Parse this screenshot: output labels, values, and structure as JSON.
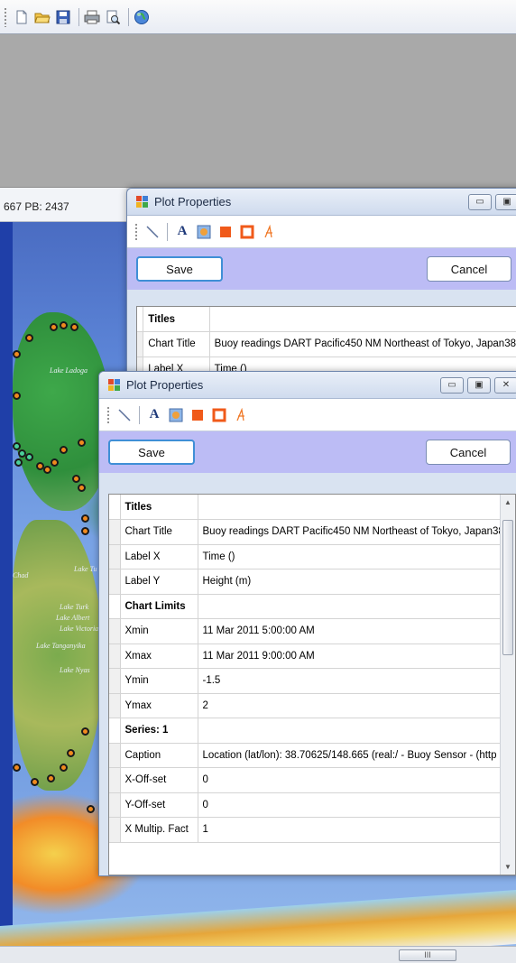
{
  "app": {
    "toolbar": {
      "icons": [
        "new-document-icon",
        "open-folder-icon",
        "save-icon",
        "print-icon",
        "print-preview-icon",
        "globe-icon"
      ]
    },
    "status": {
      "coordinates": "667 PB: 2437"
    },
    "scrollbar_thumb": "III"
  },
  "map": {
    "lake_labels": [
      "Lake Ladoga",
      "Lake Tu",
      "Chad",
      "Lake Turk",
      "Lake Albert",
      "Lake Victoria",
      "Lake Tanganyika",
      "Lake Nyas"
    ]
  },
  "colors": {
    "button_row": "#bcbcf5",
    "map_dot_orange": "#f08a1e",
    "map_dot_green": "#4ad09a",
    "focus_border": "#3f8fd6"
  },
  "dialog_back": {
    "title": "Plot Properties",
    "save_label": "Save",
    "cancel_label": "Cancel",
    "rows": [
      {
        "key": "Titles",
        "value": "",
        "section": true
      },
      {
        "key": "Chart Title",
        "value": "Buoy readings DART Pacific450 NM Northeast of Tokyo, Japan38",
        "section": false
      },
      {
        "key": "Label X",
        "value": "Time ()",
        "section": false
      }
    ]
  },
  "dialog_front": {
    "title": "Plot Properties",
    "save_label": "Save",
    "cancel_label": "Cancel",
    "toolbar_icons": [
      "line-tool-icon",
      "text-tool-icon",
      "image-tool-icon",
      "fill-color-icon",
      "border-color-icon",
      "font-color-icon"
    ],
    "rows": [
      {
        "key": "Titles",
        "value": "",
        "section": true
      },
      {
        "key": "Chart Title",
        "value": "Buoy readings DART Pacific450 NM Northeast of Tokyo, Japan38",
        "section": false
      },
      {
        "key": "Label X",
        "value": "Time ()",
        "section": false
      },
      {
        "key": "Label Y",
        "value": "Height (m)",
        "section": false
      },
      {
        "key": "Chart Limits",
        "value": "",
        "section": true
      },
      {
        "key": "Xmin",
        "value": "11 Mar 2011 5:00:00 AM",
        "section": false
      },
      {
        "key": "Xmax",
        "value": "11 Mar 2011 9:00:00 AM",
        "section": false
      },
      {
        "key": "Ymin",
        "value": "-1.5",
        "section": false
      },
      {
        "key": "Ymax",
        "value": "2",
        "section": false
      },
      {
        "key": "Series: 1",
        "value": "",
        "section": true
      },
      {
        "key": "Caption",
        "value": "Location (lat/lon): 38.70625/148.665 (real:/ - Buoy Sensor - (http",
        "section": false
      },
      {
        "key": "X-Off-set",
        "value": "0",
        "section": false
      },
      {
        "key": "Y-Off-set",
        "value": "0",
        "section": false
      },
      {
        "key": "X Multip. Fact",
        "value": "1",
        "section": false
      }
    ]
  }
}
